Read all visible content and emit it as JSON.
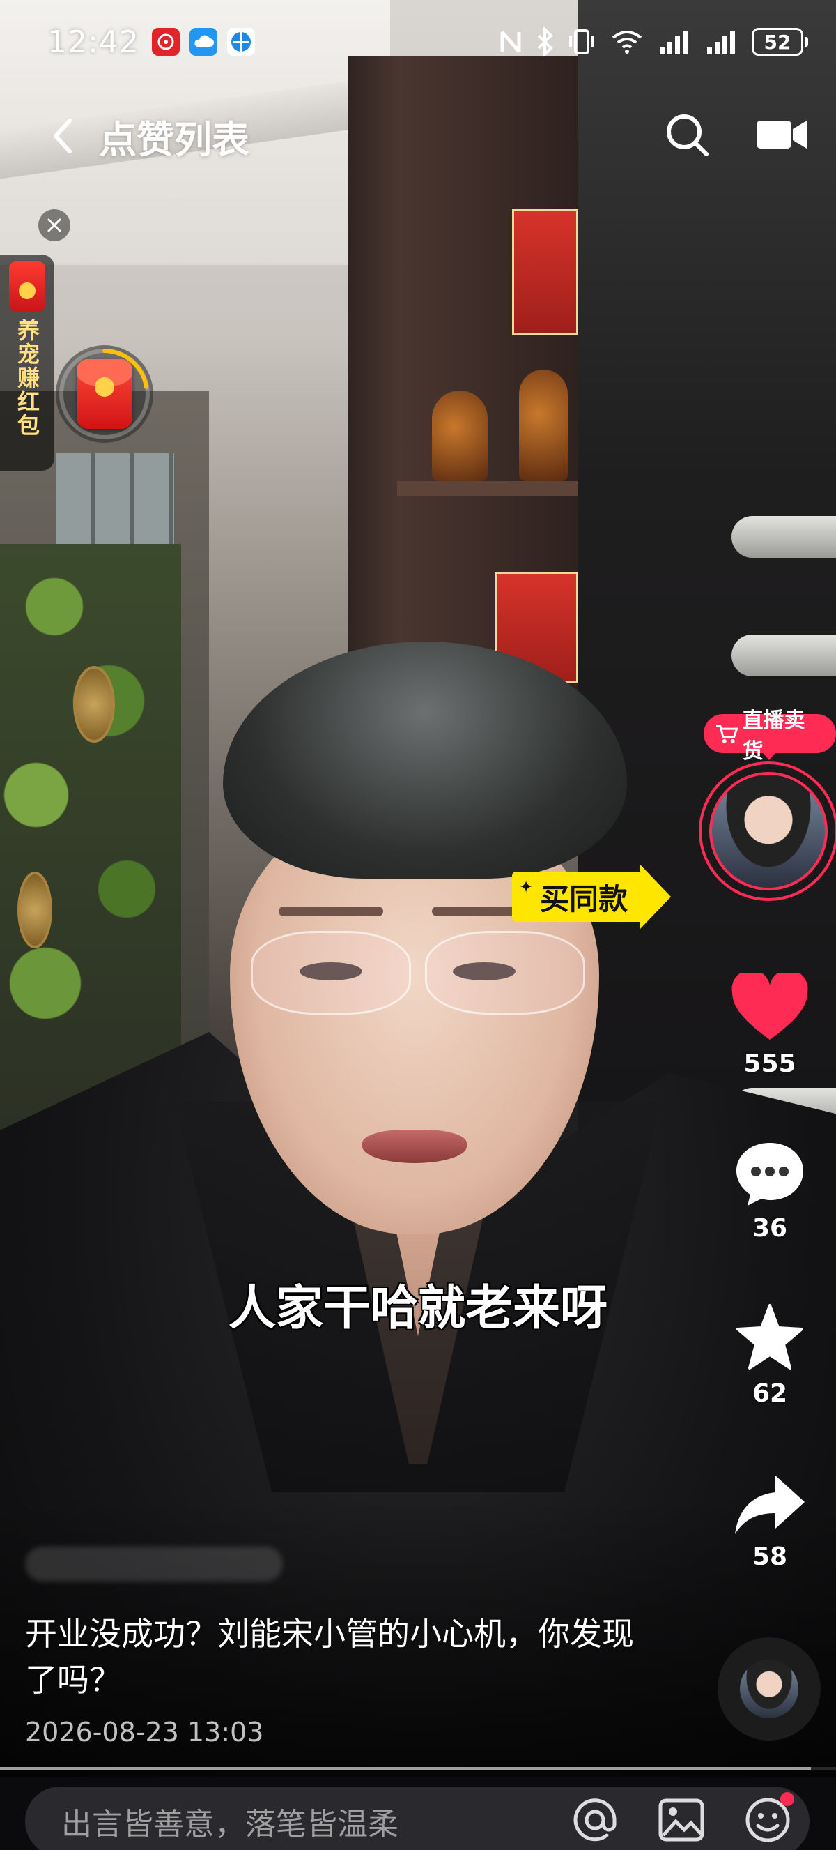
{
  "status_bar": {
    "time": "12:42",
    "notification_icons": [
      "fortune-app-icon",
      "cloud-icon",
      "browser-icon"
    ],
    "system_icons": [
      "nfc-icon",
      "bluetooth-icon",
      "vibrate-icon",
      "wifi-icon",
      "signal-icon",
      "signal-icon"
    ],
    "battery_level": "52"
  },
  "nav": {
    "title": "点赞列表",
    "back_icon": "chevron-left-icon",
    "search_icon": "search-icon",
    "camera_icon": "camera-icon"
  },
  "promo": {
    "side_label": "养宠赚红包",
    "close_icon": "close-icon",
    "packet_icon": "red-packet-icon"
  },
  "shopping_tag": {
    "label": "买同款"
  },
  "sidebar": {
    "live_tag": "直播卖货",
    "likes": "555",
    "comments": "36",
    "favorites": "62",
    "shares": "58"
  },
  "video": {
    "subtitle": "人家干哈就老来呀",
    "caption": "开业没成功？刘能宋小管的小心机，你发现了吗？",
    "date": "2026-08-23 13:03",
    "progress": 0.97
  },
  "comment_bar": {
    "placeholder": "出言皆善意，落笔皆温柔",
    "tools": [
      "at-icon",
      "image-icon",
      "emoji-icon"
    ]
  },
  "colors": {
    "accent": "#fe2c55",
    "like": "#fe2c55",
    "tag_yellow": "#ffe600"
  }
}
